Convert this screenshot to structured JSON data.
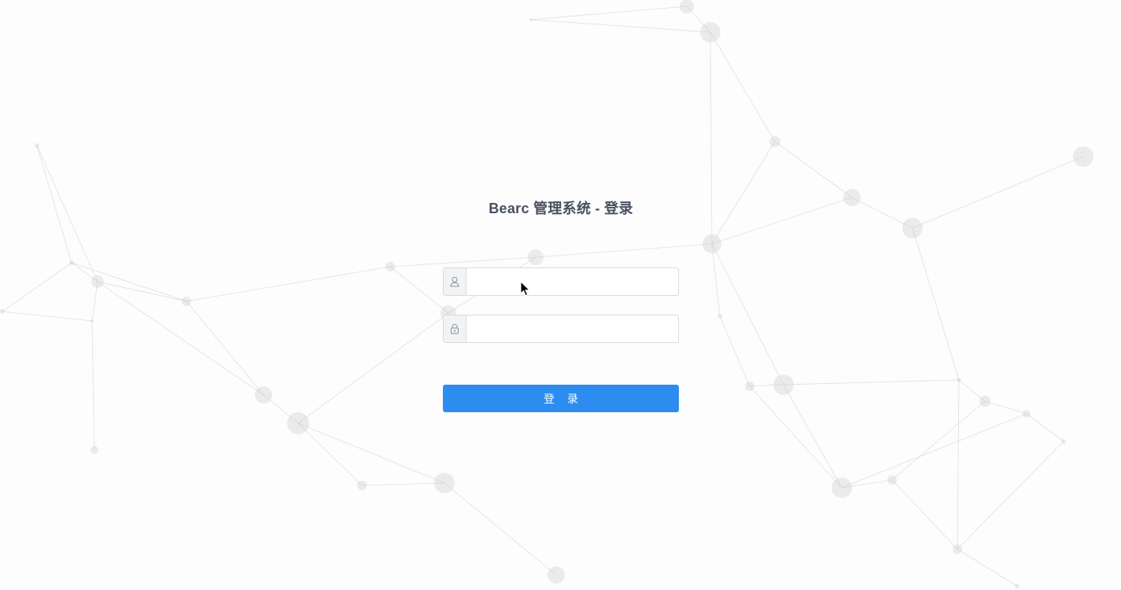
{
  "login": {
    "title": "Bearc 管理系统 - 登录",
    "username": {
      "value": "",
      "placeholder": "",
      "icon": "user-icon"
    },
    "password": {
      "value": "",
      "placeholder": "",
      "icon": "lock-icon"
    },
    "submit_label": "登 录"
  },
  "colors": {
    "primary": "#2d8cf0",
    "title": "#48505e",
    "input_border": "#d7dbe0",
    "addon_background": "#f2f3f5",
    "background_network": "#c8c8c8"
  }
}
